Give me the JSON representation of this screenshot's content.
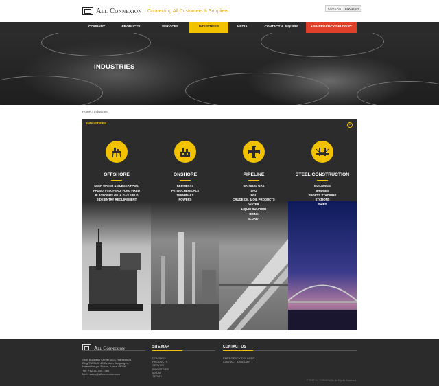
{
  "header": {
    "brand": "All Connexion",
    "tagline": "Connecting All Customers & Suppliers",
    "lang": [
      "KOREAN",
      "ENGLISH"
    ]
  },
  "nav": {
    "items": [
      {
        "label": "COMPANY"
      },
      {
        "label": "PRODUCTS"
      },
      {
        "label": "SERVICES"
      },
      {
        "label": "INDUSTRIES"
      },
      {
        "label": "MEDIA"
      },
      {
        "label": "CONTACT & INQUIRY"
      },
      {
        "label": "EMERGENCY DELIVERY"
      }
    ]
  },
  "hero": {
    "title": "INDUSTRIES"
  },
  "breadcrumb": "Home > Industries",
  "panel": {
    "title": "INDUSTRIES",
    "close_icon": "close-circle-icon",
    "accent": "#f2c200",
    "columns": [
      {
        "name": "OFFSHORE",
        "icon": "offshore-platform-icon",
        "items": [
          "DEEP WATER & SUBSEA FPSO,",
          "FPDSO, FSO, FSRU, FLNG FIXED",
          "PLATFORMS OIL & GAS FIELD",
          "SIDE ENTRY REQUIREMENT"
        ]
      },
      {
        "name": "ONSHORE",
        "icon": "refinery-icon",
        "items": [
          "REFINERYS",
          "PETROCHEMICALS",
          "TERMINALS",
          "POWERS"
        ]
      },
      {
        "name": "PIPELINE",
        "icon": "pipe-cross-icon",
        "items": [
          "NATURAL GAS",
          "LPG",
          "NGL",
          "CRUDE OIL & OIL PRODUCTS",
          "WATER",
          "LIQUID SULPHUR",
          "BRINE",
          "SLURRY"
        ]
      },
      {
        "name": "STEEL CONSTRUCTION",
        "icon": "bridge-icon",
        "items": [
          "BUILDINGS",
          "BRIDGES",
          "SPORTS STADIUMS",
          "STATIONS",
          "SHIPS"
        ]
      }
    ]
  },
  "footer": {
    "brand": "All Connexion",
    "address": [
      "SMK Business Center, ACE Hightech 21",
      "Bldg TUEN-B, 48 Centum Jungang-ro,",
      "Haeundae-gu, Busan, Korea 48059",
      "Tel : +82-51-744-7460",
      "Mail : sales@allconnexion.com"
    ],
    "sitemap_title": "SITE MAP",
    "sitemap": [
      "COMPANY",
      "PRODUCTS",
      "SERVICE",
      "INDUSTRIES",
      "MEDIA",
      "TERMS"
    ],
    "contact_title": "CONTACT US",
    "contact": [
      "EMERGENCY DELIVERY",
      "CONTACT & INQUIRY"
    ],
    "copyright": "© 2017 ALLCONNEXION. All Rights Reserved."
  }
}
